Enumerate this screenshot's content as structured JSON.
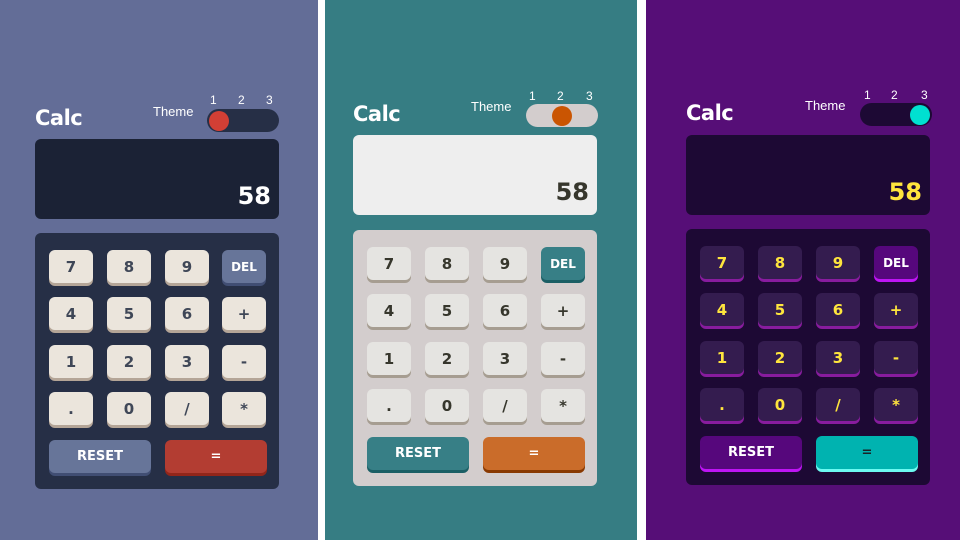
{
  "app_title": "Calc",
  "theme_label": "Theme",
  "theme_options": [
    "1",
    "2",
    "3"
  ],
  "display_value": "58",
  "keys": {
    "seven": "7",
    "eight": "8",
    "nine": "9",
    "del": "DEL",
    "four": "4",
    "five": "5",
    "six": "6",
    "plus": "+",
    "one": "1",
    "two": "2",
    "three": "3",
    "minus": "-",
    "decimal": ".",
    "zero": "0",
    "divide": "/",
    "multiply": "*",
    "reset": "RESET",
    "equals": "="
  },
  "themes": [
    {
      "id": "1",
      "active_toggle": 1,
      "background": "#636d97",
      "keypad": "#262f46",
      "screen": "#1b2235",
      "key_accent": "#677599",
      "key_equals": "#b33d32",
      "toggle_knob": "#d23f35"
    },
    {
      "id": "2",
      "active_toggle": 2,
      "background": "#367d83",
      "keypad": "#d3cdcd",
      "screen": "#eeeeee",
      "key_accent": "#377f86",
      "key_equals": "#ca6c2a",
      "toggle_knob": "#ca5502"
    },
    {
      "id": "3",
      "active_toggle": 3,
      "background": "#560e77",
      "keypad": "#1d0934",
      "screen": "#1d0934",
      "key_accent": "#56077c",
      "key_equals": "#00b3b0",
      "toggle_knob": "#00e0d1"
    }
  ]
}
